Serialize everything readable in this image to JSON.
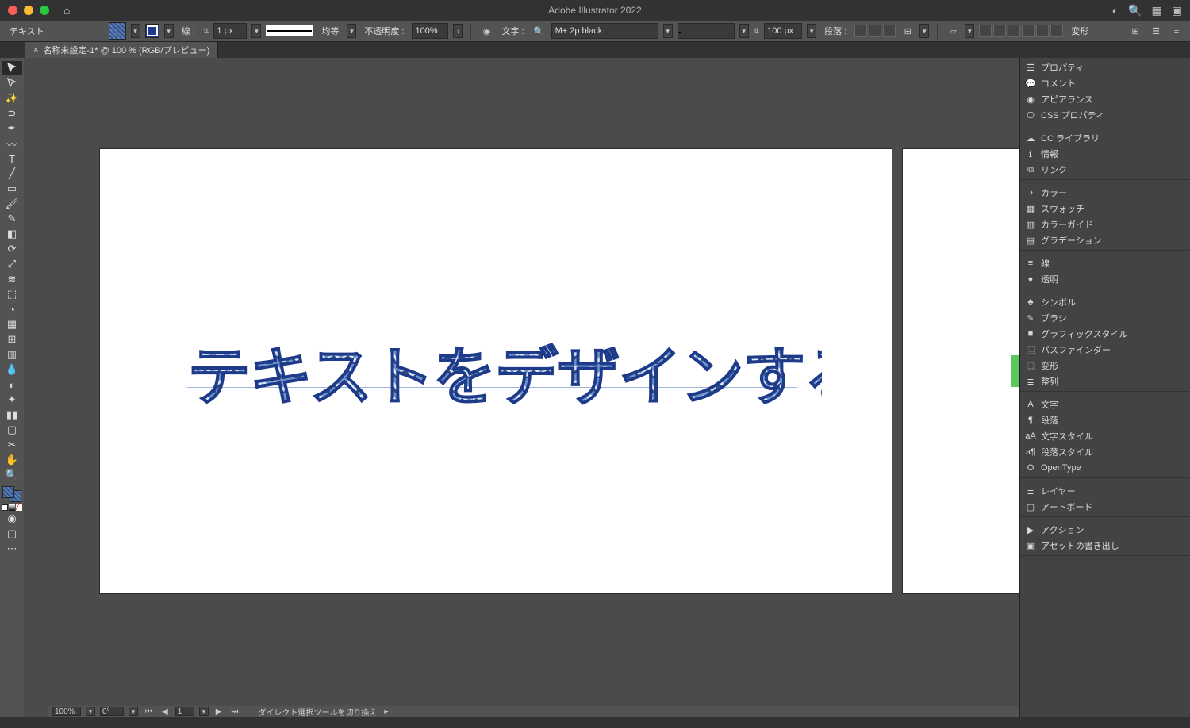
{
  "title_bar": {
    "app_title": "Adobe Illustrator 2022"
  },
  "control_bar": {
    "context_label": "テキスト",
    "stroke_label": "線 :",
    "stroke_width": "1 px",
    "stroke_style": "均等",
    "opacity_label": "不透明度 :",
    "opacity_value": "100%",
    "char_label": "文字 :",
    "font_name": "M+ 2p black",
    "font_style": "-",
    "font_size": "100 px",
    "paragraph_label": "段落 :",
    "transform_label": "変形"
  },
  "doc_tab": {
    "close": "×",
    "label": "名称未設定-1* @ 100 % (RGB/プレビュー)"
  },
  "canvas": {
    "text_content": "テキストをデザインする。"
  },
  "panels": {
    "group1": [
      "プロパティ",
      "コメント",
      "アピアランス",
      "CSS プロパティ"
    ],
    "group2": [
      "CC ライブラリ",
      "情報",
      "リンク"
    ],
    "group3": [
      "カラー",
      "スウォッチ",
      "カラーガイド",
      "グラデーション"
    ],
    "group4": [
      "線",
      "透明"
    ],
    "group5": [
      "シンボル",
      "ブラシ",
      "グラフィックスタイル",
      "パスファインダー",
      "変形",
      "整列"
    ],
    "group6": [
      "文字",
      "段落",
      "文字スタイル",
      "段落スタイル",
      "OpenType"
    ],
    "group7": [
      "レイヤー",
      "アートボード"
    ],
    "group8": [
      "アクション",
      "アセットの書き出し"
    ]
  },
  "panel_icons": {
    "group1": [
      "☰",
      "💬",
      "◉",
      "⎔"
    ],
    "group2": [
      "☁",
      "ℹ",
      "⧉"
    ],
    "group3": [
      "◑",
      "▦",
      "▥",
      "▤"
    ],
    "group4": [
      "≡",
      "●"
    ],
    "group5": [
      "♣",
      "✎",
      "■",
      "⿺",
      "⿴",
      "≣"
    ],
    "group6": [
      "A",
      "¶",
      "aA",
      "a¶",
      "O"
    ],
    "group7": [
      "≣",
      "▢"
    ],
    "group8": [
      "▶",
      "▣"
    ]
  },
  "status": {
    "zoom": "100%",
    "rotation": "0°",
    "artboard": "1",
    "tool_hint": "ダイレクト選択ツールを切り換え"
  }
}
